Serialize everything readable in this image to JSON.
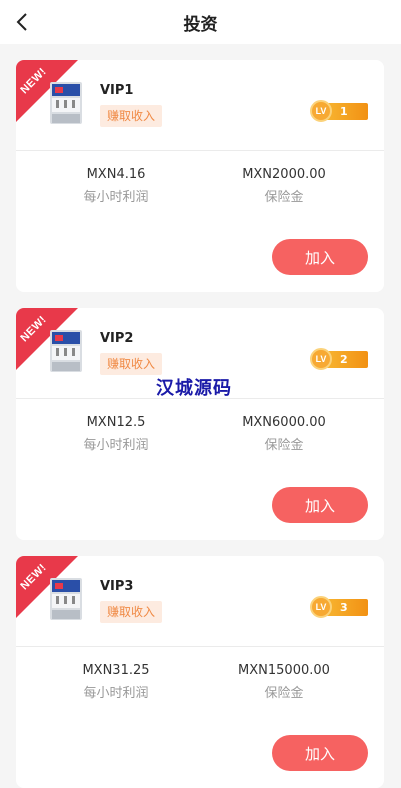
{
  "header": {
    "title": "投资",
    "back_icon": "chevron-left-icon"
  },
  "watermark": "汉城源码",
  "cards": [
    {
      "ribbon": "NEW!",
      "name": "VIP1",
      "tag": "赚取收入",
      "lv_prefix": "LV",
      "level": "1",
      "profit_value": "MXN4.16",
      "profit_label": "每小时利润",
      "deposit_value": "MXN2000.00",
      "deposit_label": "保险金",
      "button": "加入"
    },
    {
      "ribbon": "NEW!",
      "name": "VIP2",
      "tag": "赚取收入",
      "lv_prefix": "LV",
      "level": "2",
      "profit_value": "MXN12.5",
      "profit_label": "每小时利润",
      "deposit_value": "MXN6000.00",
      "deposit_label": "保险金",
      "button": "加入"
    },
    {
      "ribbon": "NEW!",
      "name": "VIP3",
      "tag": "赚取收入",
      "lv_prefix": "LV",
      "level": "3",
      "profit_value": "MXN31.25",
      "profit_label": "每小时利润",
      "deposit_value": "MXN15000.00",
      "deposit_label": "保险金",
      "button": "加入"
    }
  ],
  "colors": {
    "ribbon": "#e8394a",
    "button": "#f66261",
    "tag_bg": "#fdebe0",
    "tag_text": "#f08a45",
    "level": "#f29113"
  }
}
